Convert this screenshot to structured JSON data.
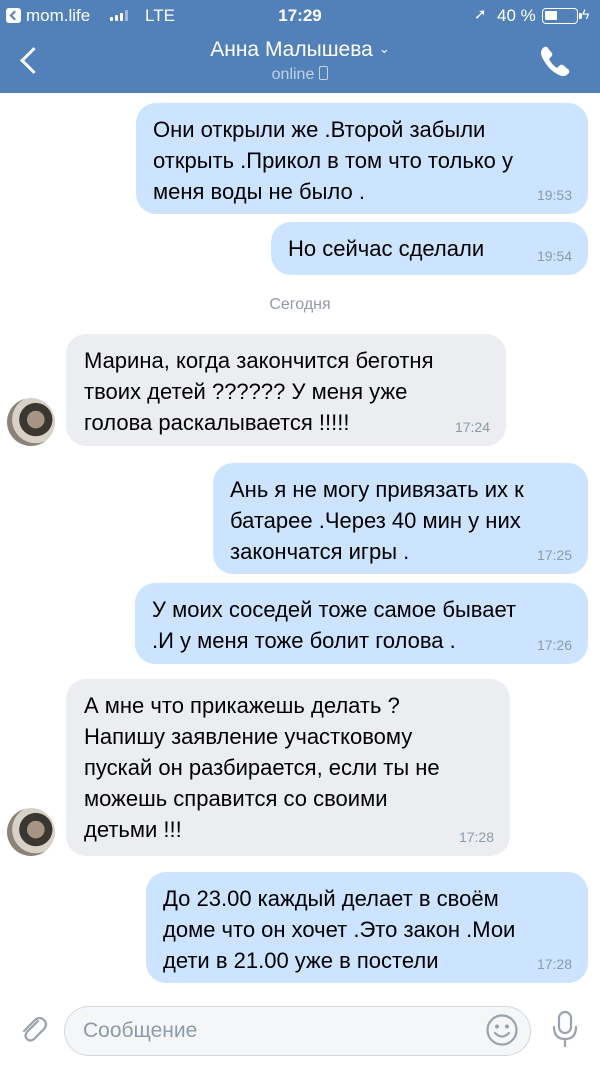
{
  "status_bar": {
    "carrier": "mom.life",
    "network": "LTE",
    "time": "17:29",
    "battery": "40 %",
    "battery_level": 0.4
  },
  "header": {
    "contact_name": "Анна Малышева",
    "presence": "online"
  },
  "messages": [
    {
      "direction": "out",
      "text": "Они открыли же .Второй забыли\nоткрыть .Прикол в том что только у\nменя воды не было .",
      "time": "19:53"
    },
    {
      "direction": "out",
      "text": "Но сейчас сделали",
      "time": "19:54"
    },
    {
      "direction": "in",
      "text": "Марина, когда закончится беготня\nтвоих детей ?????? У меня уже\nголова раскалывается !!!!!",
      "time": "17:24"
    },
    {
      "direction": "out",
      "text": "Ань я не могу привязать их к\nбатарее .Через 40 мин у них\nзакончатся игры .",
      "time": "17:25"
    },
    {
      "direction": "out",
      "text": "У моих соседей тоже самое бывает\n.И у меня тоже болит голова .",
      "time": "17:26"
    },
    {
      "direction": "in",
      "text": "А мне что прикажешь делать ?\nНапишу заявление участковому\nпускай он разбирается, если ты не\nможешь справится со своими\nдетьми !!!",
      "time": "17:28"
    },
    {
      "direction": "out",
      "text": "До 23.00 каждый делает в своём\nдоме что он хочет .Это закон .Мои\nдети в 21.00 уже в постели",
      "time": "17:28"
    }
  ],
  "date_separator": "Сегодня",
  "composer": {
    "placeholder": "Сообщение"
  },
  "colors": {
    "header": "#5181b8",
    "outgoing_bubble": "#cce4ff",
    "incoming_bubble": "#ebedf0",
    "icon": "#99a2ad"
  }
}
